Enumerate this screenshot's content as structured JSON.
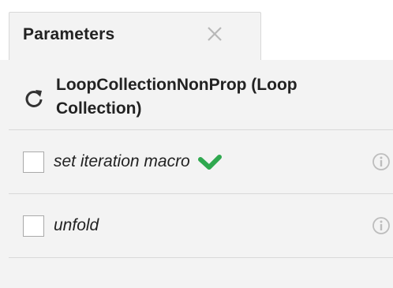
{
  "tab": {
    "title": "Parameters",
    "close_icon": "close-icon"
  },
  "header": {
    "icon": "loop-refresh-icon",
    "title": "LoopCollectionNonProp (Loop Collection)"
  },
  "parameters": [
    {
      "label": "set iteration macro",
      "checked": false,
      "status_icon": "checkmark-icon",
      "info_icon": "info-icon"
    },
    {
      "label": "unfold",
      "checked": false,
      "info_icon": "info-icon"
    }
  ],
  "colors": {
    "check_green": "#2fa84f",
    "icon_grey": "#bdbdbd",
    "panel_bg": "#f3f3f3",
    "text": "#222222"
  }
}
